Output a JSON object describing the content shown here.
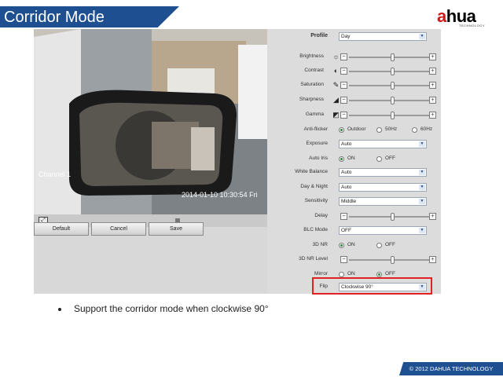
{
  "slide": {
    "title": "Corridor Mode",
    "bullet": "Support the corridor mode when clockwise 90°",
    "footer": "© 2012 DAHUA TECHNOLOGY",
    "logo": {
      "prefix": "a",
      "main": "hua",
      "sub": "TECHNOLOGY"
    }
  },
  "video": {
    "channel": "Channel 1",
    "timestamp": "2014-01-10 10:30:54 Fri"
  },
  "buttons": {
    "default": "Default",
    "cancel": "Cancel",
    "save": "Save"
  },
  "settings": {
    "profile": {
      "label": "Profile",
      "value": "Day"
    },
    "brightness": {
      "label": "Brightness",
      "level": 0.55,
      "icon": "sun-icon"
    },
    "contrast": {
      "label": "Contrast",
      "level": 0.55,
      "icon": "contrast-icon"
    },
    "saturation": {
      "label": "Saturation",
      "level": 0.55,
      "icon": "saturation-icon"
    },
    "sharpness": {
      "label": "Sharpness",
      "level": 0.55,
      "icon": "sharpness-icon"
    },
    "gamma": {
      "label": "Gamma",
      "level": 0.55,
      "icon": "gamma-icon"
    },
    "anti_flicker": {
      "label": "Anti-flicker",
      "options": [
        "Outdoor",
        "50Hz",
        "60Hz"
      ],
      "selected": "Outdoor"
    },
    "exposure": {
      "label": "Exposure",
      "value": "Auto"
    },
    "auto_iris": {
      "label": "Auto Iris",
      "options": [
        "ON",
        "OFF"
      ],
      "selected": "ON"
    },
    "white_balance": {
      "label": "White Balance",
      "value": "Auto"
    },
    "day_night": {
      "label": "Day & Night",
      "value": "Auto"
    },
    "sensitivity": {
      "label": "Sensitivity",
      "value": "Middle"
    },
    "delay": {
      "label": "Delay",
      "level": 0.55
    },
    "blc_mode": {
      "label": "BLC Mode",
      "value": "OFF"
    },
    "nr3d": {
      "label": "3D NR",
      "options": [
        "ON",
        "OFF"
      ],
      "selected": "ON"
    },
    "nr3d_level": {
      "label": "3D NR Level",
      "level": 0.55
    },
    "mirror": {
      "label": "Mirror",
      "options": [
        "ON",
        "OFF"
      ],
      "selected": "OFF"
    },
    "flip": {
      "label": "Flip",
      "value": "Clockwise 90°"
    }
  },
  "colors": {
    "accent": "#1d4f91",
    "highlight": "#e22222",
    "logo_red": "#cc1a1a"
  }
}
